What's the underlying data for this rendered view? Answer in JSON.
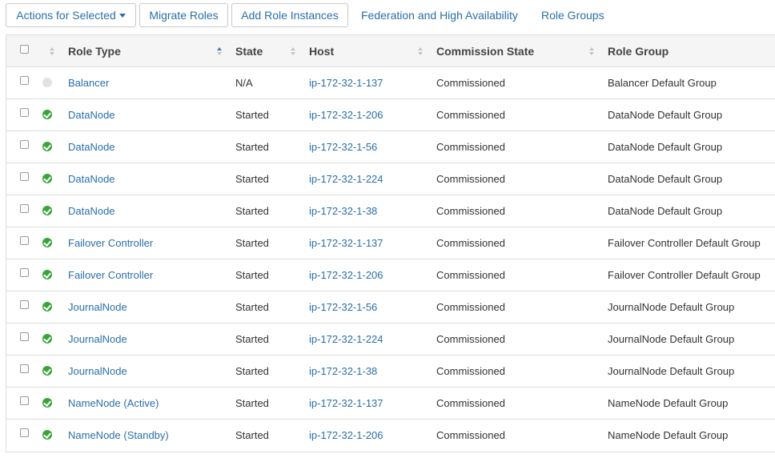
{
  "toolbar": {
    "actions_label": "Actions for Selected",
    "migrate_label": "Migrate Roles",
    "add_label": "Add Role Instances",
    "federation_label": "Federation and High Availability",
    "role_groups_label": "Role Groups"
  },
  "table": {
    "columns": {
      "role_type": "Role Type",
      "state": "State",
      "host": "Host",
      "commission_state": "Commission State",
      "role_group": "Role Group"
    },
    "sorted_column": "role_type",
    "sort_direction": "ascending",
    "rows": [
      {
        "status": "unknown",
        "role_type": "Balancer",
        "state": "N/A",
        "host": "ip-172-32-1-137",
        "commission": "Commissioned",
        "role_group": "Balancer Default Group"
      },
      {
        "status": "good",
        "role_type": "DataNode",
        "state": "Started",
        "host": "ip-172-32-1-206",
        "commission": "Commissioned",
        "role_group": "DataNode Default Group"
      },
      {
        "status": "good",
        "role_type": "DataNode",
        "state": "Started",
        "host": "ip-172-32-1-56",
        "commission": "Commissioned",
        "role_group": "DataNode Default Group"
      },
      {
        "status": "good",
        "role_type": "DataNode",
        "state": "Started",
        "host": "ip-172-32-1-224",
        "commission": "Commissioned",
        "role_group": "DataNode Default Group"
      },
      {
        "status": "good",
        "role_type": "DataNode",
        "state": "Started",
        "host": "ip-172-32-1-38",
        "commission": "Commissioned",
        "role_group": "DataNode Default Group"
      },
      {
        "status": "good",
        "role_type": "Failover Controller",
        "state": "Started",
        "host": "ip-172-32-1-137",
        "commission": "Commissioned",
        "role_group": "Failover Controller Default Group"
      },
      {
        "status": "good",
        "role_type": "Failover Controller",
        "state": "Started",
        "host": "ip-172-32-1-206",
        "commission": "Commissioned",
        "role_group": "Failover Controller Default Group"
      },
      {
        "status": "good",
        "role_type": "JournalNode",
        "state": "Started",
        "host": "ip-172-32-1-56",
        "commission": "Commissioned",
        "role_group": "JournalNode Default Group"
      },
      {
        "status": "good",
        "role_type": "JournalNode",
        "state": "Started",
        "host": "ip-172-32-1-224",
        "commission": "Commissioned",
        "role_group": "JournalNode Default Group"
      },
      {
        "status": "good",
        "role_type": "JournalNode",
        "state": "Started",
        "host": "ip-172-32-1-38",
        "commission": "Commissioned",
        "role_group": "JournalNode Default Group"
      },
      {
        "status": "good",
        "role_type": "NameNode (Active)",
        "state": "Started",
        "host": "ip-172-32-1-137",
        "commission": "Commissioned",
        "role_group": "NameNode Default Group"
      },
      {
        "status": "good",
        "role_type": "NameNode (Standby)",
        "state": "Started",
        "host": "ip-172-32-1-206",
        "commission": "Commissioned",
        "role_group": "NameNode Default Group"
      }
    ]
  },
  "colors": {
    "link": "#2a6fa8",
    "status_good": "#3aa33a",
    "status_unknown": "#e2e2e2",
    "header_bg": "#f5f5f5"
  }
}
